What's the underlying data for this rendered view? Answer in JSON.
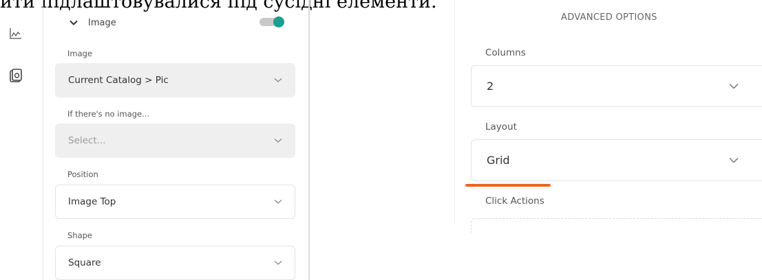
{
  "top_text": "ити підлаштовувалися під сусідні елементи.",
  "left_panel": {
    "section": {
      "title": "Image",
      "toggle_on": true
    },
    "fields": [
      {
        "label": "Image",
        "value": "Current Catalog > Pic"
      },
      {
        "label": "If there's no image...",
        "placeholder": "Select..."
      },
      {
        "label": "Position",
        "value": "Image Top"
      },
      {
        "label": "Shape",
        "value": "Square"
      }
    ]
  },
  "right_panel": {
    "title": "ADVANCED OPTIONS",
    "fields": [
      {
        "label": "Columns",
        "value": "2"
      },
      {
        "label": "Layout",
        "value": "Grid"
      },
      {
        "label": "Click Actions"
      }
    ]
  },
  "icons": [
    "chart-icon",
    "document-icon",
    "chevron-down-icon",
    "caret-down-icon"
  ],
  "colors": {
    "accent": "#1a9e8e",
    "highlight": "#f0651c"
  }
}
